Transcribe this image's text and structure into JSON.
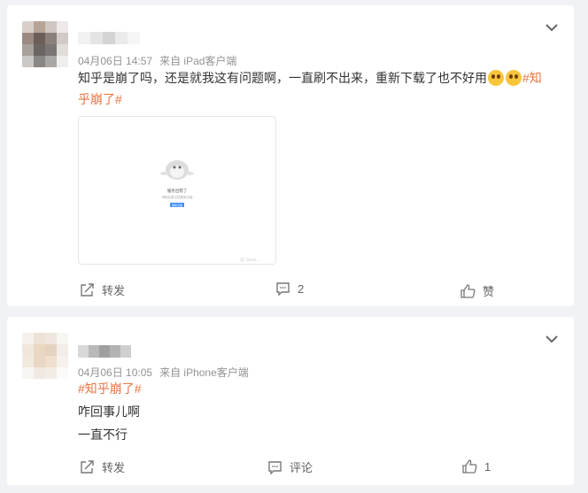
{
  "posts": [
    {
      "meta": {
        "date": "04月06日 14:57",
        "source": "来自 iPad客户端"
      },
      "text_line1": "知乎是崩了吗，还是就我这有问题啊，一直刷不出来，重新下载了也不好用",
      "topic_part1": "#知",
      "topic_part2": "乎崩了#",
      "image": {
        "title": "服务出错了",
        "subtitle": "请稍后重试或刷新页面",
        "button": "刷新页面",
        "watermark": "@ Saca..."
      },
      "actions": {
        "repost": "转发",
        "comment": "2",
        "like": "赞"
      }
    },
    {
      "meta": {
        "date": "04月06日 10:05",
        "source": "来自 iPhone客户端"
      },
      "topic": "#知乎崩了#",
      "lines": [
        "咋回事儿啊",
        "一直不行"
      ],
      "actions": {
        "repost": "转发",
        "comment": "评论",
        "like": "1"
      }
    }
  ],
  "colors": {
    "topic": "#eb7340",
    "meta": "#939393",
    "text": "#333333"
  },
  "icons": [
    "chevron-down-icon",
    "repost-icon",
    "comment-icon",
    "like-icon",
    "emoji-dizzy",
    "emoji-thinking"
  ]
}
